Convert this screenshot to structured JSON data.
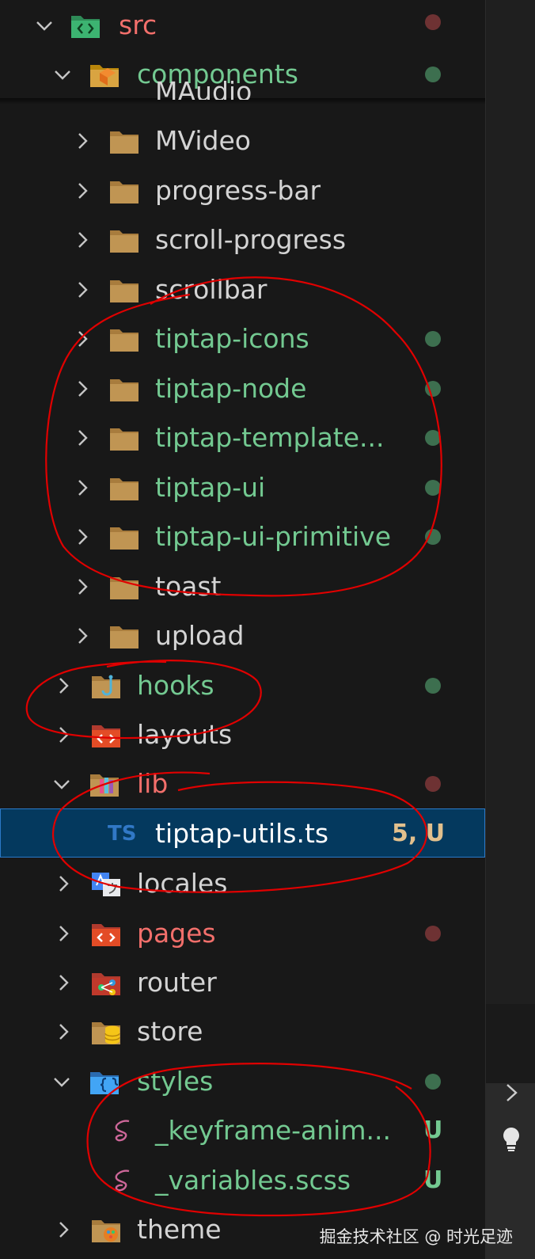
{
  "tree": {
    "src": {
      "label": "src"
    },
    "components": {
      "label": "components"
    },
    "partial": {
      "label": "MAudio"
    },
    "mvideo": {
      "label": "MVideo"
    },
    "progress_bar": {
      "label": "progress-bar"
    },
    "scroll_progress": {
      "label": "scroll-progress"
    },
    "scrollbar": {
      "label": "scrollbar"
    },
    "tiptap_icons": {
      "label": "tiptap-icons"
    },
    "tiptap_node": {
      "label": "tiptap-node"
    },
    "tiptap_templates": {
      "label": "tiptap-template..."
    },
    "tiptap_ui": {
      "label": "tiptap-ui"
    },
    "tiptap_ui_primitive": {
      "label": "tiptap-ui-primitive"
    },
    "toast": {
      "label": "toast"
    },
    "upload": {
      "label": "upload"
    },
    "hooks": {
      "label": "hooks"
    },
    "layouts": {
      "label": "layouts"
    },
    "lib": {
      "label": "lib"
    },
    "tiptap_utils": {
      "label": "tiptap-utils.ts",
      "icon_text": "TS",
      "status": "5, U"
    },
    "locales": {
      "label": "locales"
    },
    "pages": {
      "label": "pages"
    },
    "router": {
      "label": "router"
    },
    "store": {
      "label": "store"
    },
    "styles": {
      "label": "styles"
    },
    "keyframe": {
      "label": "_keyframe-anim...",
      "status": "U"
    },
    "variables": {
      "label": "_variables.scss",
      "status": "U"
    },
    "theme": {
      "label": "theme"
    }
  },
  "colors": {
    "git_modified": "#73c991",
    "git_error": "#f26f6b",
    "selection": "#04395e",
    "folder": "#c09553",
    "annotation": "#e00000"
  },
  "watermark": "掘金技术社区 @ 时光足迹"
}
